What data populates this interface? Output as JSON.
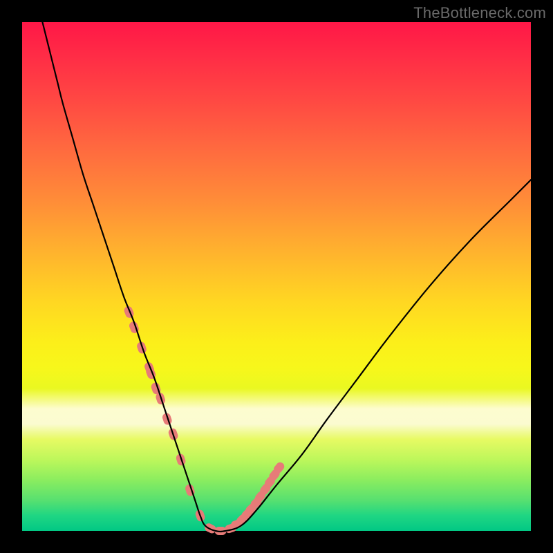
{
  "watermark": "TheBottleneck.com",
  "chart_data": {
    "type": "line",
    "title": "",
    "xlabel": "",
    "ylabel": "",
    "xlim": [
      0,
      100
    ],
    "ylim": [
      0,
      100
    ],
    "series": [
      {
        "name": "bottleneck-curve",
        "x": [
          4,
          5,
          6,
          7,
          8,
          10,
          12,
          14,
          16,
          18,
          20,
          22,
          24,
          26,
          28,
          30,
          32,
          33,
          34,
          35,
          36,
          38,
          40,
          43,
          46,
          50,
          55,
          60,
          66,
          72,
          80,
          88,
          96,
          100
        ],
        "values": [
          100,
          96,
          92,
          88,
          84,
          77,
          70,
          64,
          58,
          52,
          46,
          41,
          35,
          30,
          24,
          18,
          12,
          9,
          6,
          3,
          1,
          0,
          0,
          1,
          4,
          9,
          15,
          22,
          30,
          38,
          48,
          57,
          65,
          69
        ]
      }
    ],
    "markers": {
      "name": "highlight-points",
      "color": "#e77b78",
      "x": [
        21,
        22,
        23.5,
        25,
        25.3,
        26.3,
        27.2,
        28.5,
        29.7,
        31.2,
        33,
        35,
        37,
        39,
        41,
        42.2,
        43.2,
        44.2,
        45,
        46,
        46.8,
        47.8,
        48.7,
        49.6,
        50.5
      ],
      "values": [
        43,
        40,
        36,
        32,
        31,
        28,
        26,
        22,
        19,
        14,
        8,
        3,
        0.5,
        0,
        0.5,
        1.3,
        2.2,
        3.3,
        4.3,
        5.5,
        6.7,
        8.2,
        9.6,
        11,
        12.4
      ]
    }
  }
}
